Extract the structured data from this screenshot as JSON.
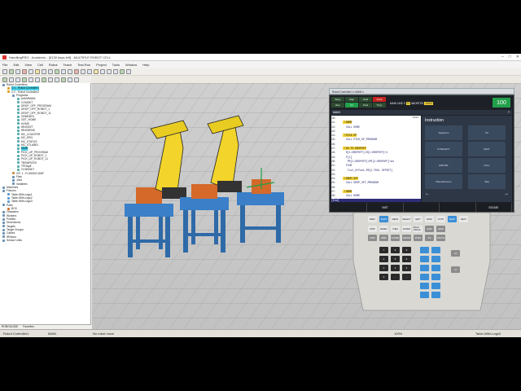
{
  "window": {
    "title": "HandlingPRO - Academic - [5130 days left] - MULTIPLE ROBOT CELL"
  },
  "menu": [
    "File",
    "Edit",
    "View",
    "Cell",
    "Robot",
    "Teach",
    "Test-Run",
    "Project",
    "Tools",
    "Window",
    "Help"
  ],
  "tree": {
    "items": [
      {
        "label": "Robot Controllers",
        "indent": 0,
        "color": "#6a8fb0"
      },
      {
        "label": "C:1 - Robot Controller1",
        "indent": 1,
        "color": "#e0a020",
        "selected": true
      },
      {
        "label": "C:2 - Robot Controller2",
        "indent": 1,
        "color": "#e0a020"
      },
      {
        "label": "Programs",
        "indent": 2,
        "color": "#6a8fb0"
      },
      {
        "label": "AAVMMAIN",
        "indent": 3,
        "color": "#5aa"
      },
      {
        "label": "COMGET",
        "indent": 3,
        "color": "#5aa"
      },
      {
        "label": "DROP_OFF_PROGRAM",
        "indent": 3,
        "color": "#5aa"
      },
      {
        "label": "DROP_OFF_ROBOT_1",
        "indent": 3,
        "color": "#5aa"
      },
      {
        "label": "DROP_OFF_ROBOT_11",
        "indent": 3,
        "color": "#5aa"
      },
      {
        "label": "GEMDATA",
        "indent": 3,
        "color": "#5aa"
      },
      {
        "label": "GET_HOME",
        "indent": 3,
        "color": "#5aa"
      },
      {
        "label": "HOME",
        "indent": 3,
        "color": "#5aa"
      },
      {
        "label": "IRNSGET",
        "indent": 3,
        "color": "#5aa"
      },
      {
        "label": "IRNSSEND",
        "indent": 3,
        "color": "#5aa"
      },
      {
        "label": "MC_COUNTER",
        "indent": 3,
        "color": "#5aa"
      },
      {
        "label": "MC_ERG",
        "indent": 3,
        "color": "#5aa"
      },
      {
        "label": "MC_STATUS",
        "indent": 3,
        "color": "#5aa"
      },
      {
        "label": "MC_STLABEL",
        "indent": 3,
        "color": "#5aa"
      },
      {
        "label": "MAIN",
        "indent": 3,
        "color": "#5aa",
        "selected": true
      },
      {
        "label": "PICK_UP_PROGRAM",
        "indent": 3,
        "color": "#5aa"
      },
      {
        "label": "PICK_UP_ROBOT_1",
        "indent": 3,
        "color": "#5aa"
      },
      {
        "label": "PICK_UP_ROBOT_11",
        "indent": 3,
        "color": "#5aa"
      },
      {
        "label": "TBSWRCRS",
        "indent": 3,
        "color": "#5aa"
      },
      {
        "label": "TPDisplt",
        "indent": 3,
        "color": "#5aa"
      },
      {
        "label": "VCMSNKT",
        "indent": 3,
        "color": "#5aa"
      },
      {
        "label": "GP: 1 - R-2000iC/165F",
        "indent": 2,
        "color": "#c84"
      },
      {
        "label": "Files",
        "indent": 2,
        "color": "#6a8fb0"
      },
      {
        "label": "Jobs",
        "indent": 2,
        "color": "#6a8fb0"
      },
      {
        "label": "Variables",
        "indent": 2,
        "color": "#6a8fb0"
      },
      {
        "label": "Machines",
        "indent": 0,
        "color": "#6a8fb0"
      },
      {
        "label": "Fixtures",
        "indent": 0,
        "color": "#6a8fb0"
      },
      {
        "label": "Table-With-Legs1",
        "indent": 1,
        "color": "#5a9ad0"
      },
      {
        "label": "Table-With-Legs2",
        "indent": 1,
        "color": "#5a9ad0"
      },
      {
        "label": "Table-With-Legs3",
        "indent": 1,
        "color": "#5a9ad0"
      },
      {
        "label": "Parts",
        "indent": 0,
        "color": "#6a8fb0"
      },
      {
        "label": "BOX",
        "indent": 1,
        "color": "#d07030"
      },
      {
        "label": "Obstacles",
        "indent": 0,
        "color": "#6a8fb0"
      },
      {
        "label": "Workers",
        "indent": 0,
        "color": "#6a8fb0"
      },
      {
        "label": "Profiles",
        "indent": 0,
        "color": "#6a8fb0"
      },
      {
        "label": "Dimensions",
        "indent": 0,
        "color": "#6a8fb0"
      },
      {
        "label": "Targets",
        "indent": 0,
        "color": "#6a8fb0"
      },
      {
        "label": "Target Groups",
        "indent": 0,
        "color": "#6a8fb0"
      },
      {
        "label": "Cables",
        "indent": 0,
        "color": "#6a8fb0"
      },
      {
        "label": "iRVision",
        "indent": 0,
        "color": "#6a8fb0"
      },
      {
        "label": "Sensor Units",
        "indent": 0,
        "color": "#6a8fb0"
      }
    ],
    "tabs": [
      "ROBOGUIDE",
      "Favorites"
    ]
  },
  "statusbar": {
    "controller": "Robot Controller1",
    "program": "MAIN",
    "robot": "No robot move",
    "zoom": "100%",
    "fixture": "Table-With-Legs3"
  },
  "teach_pendant": {
    "header": "Robot Controller1 ▾   MAIN ▾",
    "status_row1": [
      "Busy",
      "Step",
      "Hold",
      "Fault"
    ],
    "status_row2": [
      "Run",
      "I/O",
      "Prod",
      "TCyc"
    ],
    "line_info": "MAIN LINE 0",
    "t2": "T2",
    "aborted": "ABORTED",
    "jfm": "JOINT",
    "percent": "100",
    "screen_title": "MAIN",
    "line_count": "19/34",
    "program_lines": [
      {
        "ln": "10:",
        "text": "",
        "hl": false
      },
      {
        "ln": "11:",
        "text": " !HOME",
        "label": true
      },
      {
        "ln": "12:",
        "text": "  CALL HOME"
      },
      {
        "ln": "13:",
        "text": ""
      },
      {
        "ln": "14:",
        "text": " !PICK UP",
        "label": true
      },
      {
        "ln": "15:",
        "text": "  CALL PICK_UP_PROGRAM"
      },
      {
        "ln": "16:",
        "text": ""
      },
      {
        "ln": "17:",
        "text": " !GO TO DROPOFF",
        "label": true
      },
      {
        "ln": "18:",
        "text": "  R[1:DROPOFF]=R[1:DROPOFF]+1"
      },
      {
        "ln": "19:",
        "text": "  F[1]"
      },
      {
        "ln": "20:",
        "text": "   PR[1:DROPOFF]=PR[1:DROPOFF]+ws"
      },
      {
        "ln": "21:",
        "text": "  FINE"
      },
      {
        "ln": "22:",
        "text": "   Tool_Offset,PR[1:TOOL OFFSET]"
      },
      {
        "ln": "23:",
        "text": ""
      },
      {
        "ln": "24:",
        "text": " !DROP OFF",
        "label": true
      },
      {
        "ln": "25:",
        "text": "  CALL DROP_OFF_PROGRAM"
      },
      {
        "ln": "26:",
        "text": ""
      },
      {
        "ln": "27:",
        "text": " !HOME",
        "label": true
      },
      {
        "ln": "28:",
        "text": "  CALL HOME"
      },
      {
        "ln": "[End]",
        "text": "",
        "hl": true
      }
    ],
    "instruction_title": "Instruction",
    "instructions": [
      "Registers",
      "I/O",
      "IF/SELECT",
      "WAIT",
      "JMP/LBL",
      "CALL",
      "Miscellaneous",
      "Skip"
    ],
    "softkeys": [
      "",
      "INST",
      "",
      "",
      "EDCMD"
    ],
    "softkey_sub": [
      "",
      "[ INST ]",
      "",
      "",
      ""
    ]
  },
  "keypad": {
    "top_keys": [
      "PREV",
      "SHIFT",
      "MENU",
      "SELECT",
      "EDIT",
      "DATA",
      "FCTN",
      "SHIFT",
      "NEXT"
    ],
    "mid_keys": [
      "DISP",
      "RESET",
      "ITEM",
      "ENTER",
      "BACK SPACE",
      "STEP",
      "HOLD",
      "FWD",
      "BWD",
      "COORD",
      "GROUP",
      "POSN",
      "I/O",
      "STATUS"
    ],
    "digits": [
      "7",
      "8",
      "9",
      "4",
      "5",
      "6",
      "1",
      "2",
      "3",
      "0",
      ".",
      "-"
    ],
    "side": [
      "+%",
      "-%"
    ]
  },
  "colors": {
    "screen_bg": "#1d2127",
    "accent_green": "#22a04a",
    "key_blue": "#3a8fd6",
    "robot_yellow": "#f2d42a",
    "table_blue": "#3a7fc8",
    "box_orange": "#d5692a"
  }
}
